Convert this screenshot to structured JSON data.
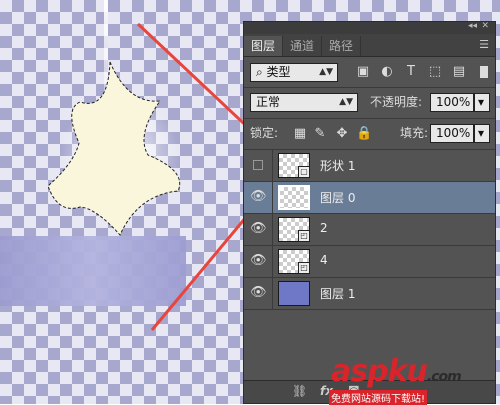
{
  "panel": {
    "tabs": [
      {
        "label": "图层",
        "active": true
      },
      {
        "label": "通道",
        "active": false
      },
      {
        "label": "路径",
        "active": false
      }
    ],
    "filter_type": "类型",
    "blend_mode": "正常",
    "opacity_label": "不透明度:",
    "opacity_value": "100%",
    "lock_label": "锁定:",
    "fill_label": "填充:",
    "fill_value": "100%",
    "layers": [
      {
        "name": "形状 1",
        "visible": false,
        "selected": false,
        "thumb": "checker"
      },
      {
        "name": "图层 0",
        "visible": true,
        "selected": true,
        "thumb": "checker"
      },
      {
        "name": "2",
        "visible": true,
        "selected": false,
        "thumb": "checker-smart"
      },
      {
        "name": "4",
        "visible": true,
        "selected": false,
        "thumb": "checker-smart"
      },
      {
        "name": "图层 1",
        "visible": true,
        "selected": false,
        "thumb": "solid"
      }
    ]
  },
  "watermark": {
    "brand": "aspku",
    "domain_suffix": ".com",
    "tagline": "免费网站源码下载站!"
  },
  "colors": {
    "arrow": "#e8453c",
    "selected_layer": "#6a7d96",
    "layer1_fill": "#6f77c7",
    "brand_red": "#d8242a",
    "brand_dark": "#2b2b2b"
  }
}
